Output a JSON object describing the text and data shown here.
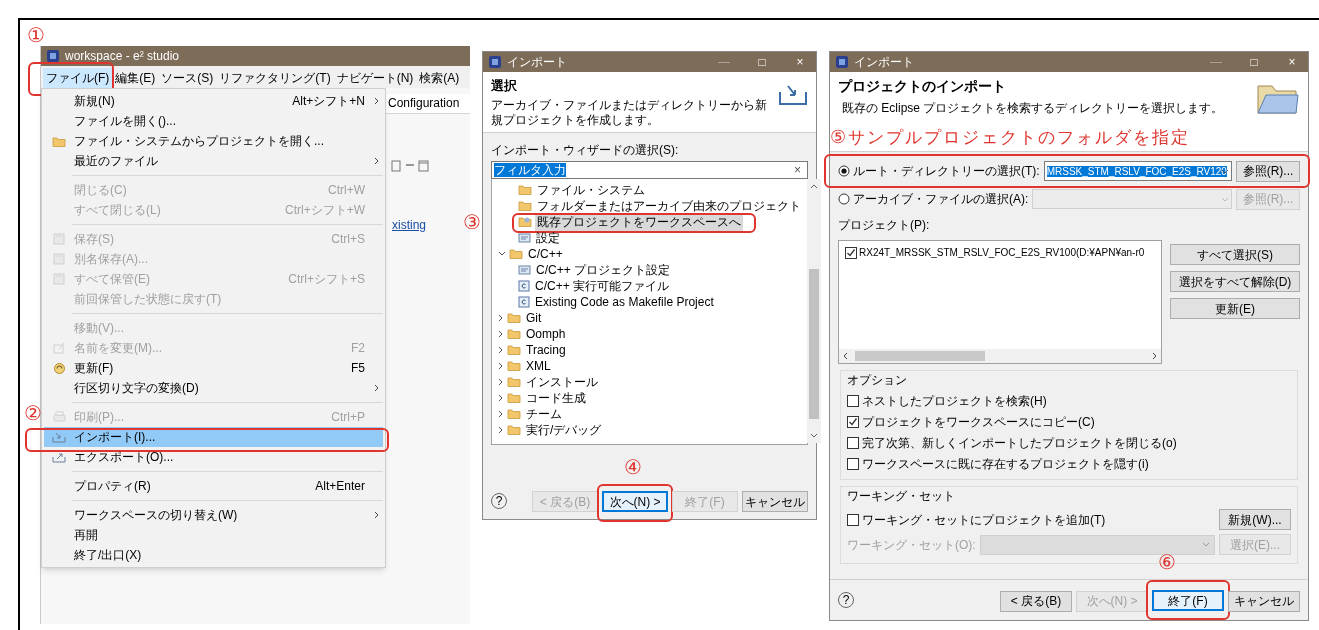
{
  "ide": {
    "title": "workspace - e² studio",
    "menubar": [
      {
        "label": "ファイル(F)",
        "selected": true,
        "callout": "①"
      },
      {
        "label": "編集(E)",
        "selected": false
      },
      {
        "label": "ソース(S)",
        "selected": false
      },
      {
        "label": "リファクタリング(T)",
        "selected": false
      },
      {
        "label": "ナビゲート(N)",
        "selected": false
      },
      {
        "label": "検索(A)",
        "selected": false
      }
    ],
    "background": {
      "tab_label": "Configuration",
      "link": "xisting"
    },
    "file_menu": {
      "groups": [
        [
          {
            "label": "新規(N)",
            "shortcut": "Alt+シフト+N",
            "submenu": true,
            "disabled": false,
            "selected": false,
            "kind": "plain"
          },
          {
            "label": "ファイルを開く()...",
            "submenu": false,
            "disabled": false,
            "selected": false,
            "kind": "plain"
          },
          {
            "label": "ファイル・システムからプロジェクトを開く...",
            "submenu": false,
            "disabled": false,
            "selected": false,
            "kind": "folder"
          },
          {
            "label": "最近のファイル",
            "submenu": true,
            "disabled": false,
            "selected": false,
            "kind": "plain"
          }
        ],
        [
          {
            "label": "閉じる(C)",
            "shortcut": "Ctrl+W",
            "submenu": false,
            "disabled": true,
            "selected": false,
            "kind": "plain"
          },
          {
            "label": "すべて閉じる(L)",
            "shortcut": "Ctrl+シフト+W",
            "submenu": false,
            "disabled": true,
            "selected": false,
            "kind": "plain"
          }
        ],
        [
          {
            "label": "保存(S)",
            "shortcut": "Ctrl+S",
            "submenu": false,
            "disabled": true,
            "selected": false,
            "kind": "save"
          },
          {
            "label": "別名保存(A)...",
            "submenu": false,
            "disabled": true,
            "selected": false,
            "kind": "save"
          },
          {
            "label": "すべて保管(E)",
            "shortcut": "Ctrl+シフト+S",
            "submenu": false,
            "disabled": true,
            "selected": false,
            "kind": "save"
          },
          {
            "label": "前回保管した状態に戻す(T)",
            "submenu": false,
            "disabled": true,
            "selected": false,
            "kind": "plain"
          }
        ],
        [
          {
            "label": "移動(V)...",
            "submenu": false,
            "disabled": true,
            "selected": false,
            "kind": "plain"
          },
          {
            "label": "名前を変更(M)...",
            "shortcut": "F2",
            "submenu": false,
            "disabled": true,
            "selected": false,
            "kind": "rename"
          },
          {
            "label": "更新(F)",
            "shortcut": "F5",
            "submenu": false,
            "disabled": false,
            "selected": false,
            "kind": "refresh"
          },
          {
            "label": "行区切り文字の変換(D)",
            "submenu": true,
            "disabled": false,
            "selected": false,
            "kind": "plain"
          }
        ],
        [
          {
            "label": "印刷(P)...",
            "shortcut": "Ctrl+P",
            "submenu": false,
            "disabled": true,
            "selected": false,
            "kind": "print"
          },
          {
            "label": "インポート(I)...",
            "submenu": false,
            "disabled": false,
            "selected": true,
            "kind": "import",
            "callout": "②"
          },
          {
            "label": "エクスポート(O)...",
            "submenu": false,
            "disabled": false,
            "selected": false,
            "kind": "export"
          }
        ],
        [
          {
            "label": "プロパティ(R)",
            "shortcut": "Alt+Enter",
            "submenu": false,
            "disabled": false,
            "selected": false,
            "kind": "plain"
          }
        ],
        [
          {
            "label": "ワークスペースの切り替え(W)",
            "submenu": true,
            "disabled": false,
            "selected": false,
            "kind": "plain"
          },
          {
            "label": "再開",
            "submenu": false,
            "disabled": false,
            "selected": false,
            "kind": "plain"
          },
          {
            "label": "終了/出口(X)",
            "submenu": false,
            "disabled": false,
            "selected": false,
            "kind": "plain"
          }
        ]
      ]
    }
  },
  "import_wizard": {
    "title": "インポート",
    "controls": [
      "—",
      "□",
      "×"
    ],
    "heading": "選択",
    "description": "アーカイブ・ファイルまたはディレクトリーから新規プロジェクトを作成します。",
    "wizard_label": "インポート・ウィザードの選択(S):",
    "filter": {
      "value": "フィルタ入力",
      "text_selected": true
    },
    "clear": "×",
    "tree": [
      {
        "label": "ファイル・システム",
        "kind": "folder",
        "selected": false
      },
      {
        "label": "フォルダーまたはアーカイブ由来のプロジェクト",
        "kind": "folder",
        "selected": false
      },
      {
        "label": "既存プロジェクトをワークスペースへ",
        "kind": "project",
        "selected": true,
        "callout": "③"
      },
      {
        "label": "設定",
        "kind": "settings",
        "selected": false
      },
      {
        "label": "C/C++",
        "kind": "folder",
        "selected": false,
        "expanded": true,
        "children": [
          {
            "label": "C/C++ プロジェクト設定",
            "kind": "settings",
            "selected": false
          },
          {
            "label": "C/C++ 実行可能ファイル",
            "kind": "c-file",
            "selected": false
          },
          {
            "label": "Existing Code as Makefile Project",
            "kind": "c-file",
            "selected": false
          }
        ]
      },
      {
        "label": "Git",
        "kind": "folder",
        "selected": false,
        "expanded": false
      },
      {
        "label": "Oomph",
        "kind": "folder",
        "selected": false,
        "expanded": false
      },
      {
        "label": "Tracing",
        "kind": "folder",
        "selected": false,
        "expanded": false
      },
      {
        "label": "XML",
        "kind": "folder",
        "selected": false,
        "expanded": false
      },
      {
        "label": "インストール",
        "kind": "folder",
        "selected": false,
        "expanded": false
      },
      {
        "label": "コード生成",
        "kind": "folder",
        "selected": false,
        "expanded": false
      },
      {
        "label": "チーム",
        "kind": "folder",
        "selected": false,
        "expanded": false
      },
      {
        "label": "実行/デバッグ",
        "kind": "folder",
        "selected": false,
        "expanded": false
      }
    ],
    "help": "?",
    "buttons": [
      {
        "label": "< 戻る(B)",
        "disabled": true,
        "default": false
      },
      {
        "label": "次へ(N) >",
        "disabled": false,
        "default": true,
        "callout": "④"
      },
      {
        "label": "終了(F)",
        "disabled": true,
        "default": false
      },
      {
        "label": "キャンセル",
        "disabled": false,
        "default": false
      }
    ]
  },
  "projects_wizard": {
    "title": "インポート",
    "controls": [
      "—",
      "□",
      "×"
    ],
    "heading": "プロジェクトのインポート",
    "description": "既存の Eclipse プロジェクトを検索するディレクトリーを選択します。",
    "sources": [
      {
        "label": "ルート・ディレクトリーの選択(T):",
        "selected": true,
        "disabled": false,
        "value": "MRSSK_STM_RSLV_FOC_E2S_RV120",
        "browse": "参照(R)...",
        "callout": "⑤",
        "callout_text": "サンプルプロジェクトのフォルダを指定"
      },
      {
        "label": "アーカイブ・ファイルの選択(A):",
        "selected": false,
        "disabled": true,
        "browse": "参照(R)..."
      }
    ],
    "projects_label": "プロジェクト(P):",
    "projects": [
      {
        "label": "RX24T_MRSSK_STM_RSLV_FOC_E2S_RV100(D:¥APN¥an-r0",
        "checked": true
      }
    ],
    "list_buttons": [
      "すべて選択(S)",
      "選択をすべて解除(D)",
      "更新(E)"
    ],
    "options": {
      "title": "オプション",
      "items": [
        {
          "label": "ネストしたプロジェクトを検索(H)",
          "checked": false
        },
        {
          "label": "プロジェクトをワークスペースにコピー(C)",
          "checked": true
        },
        {
          "label": "完了次第、新しくインポートしたプロジェクトを閉じる(o)",
          "checked": false
        },
        {
          "label": "ワークスペースに既に存在するプロジェクトを隠す(i)",
          "checked": false
        }
      ]
    },
    "working_set": {
      "title": "ワーキング・セット",
      "add_label": "ワーキング・セットにプロジェクトを追加(T)",
      "checked": false,
      "new_button": "新規(W)...",
      "field_label": "ワーキング・セット(O):",
      "select_button": "選択(E)...",
      "disabled": true
    },
    "help": "?",
    "buttons": [
      {
        "label": "< 戻る(B)",
        "disabled": false,
        "default": false
      },
      {
        "label": "次へ(N) >",
        "disabled": true,
        "default": false
      },
      {
        "label": "終了(F)",
        "disabled": false,
        "default": true,
        "callout": "⑥"
      },
      {
        "label": "キャンセル",
        "disabled": false,
        "default": false
      }
    ]
  }
}
